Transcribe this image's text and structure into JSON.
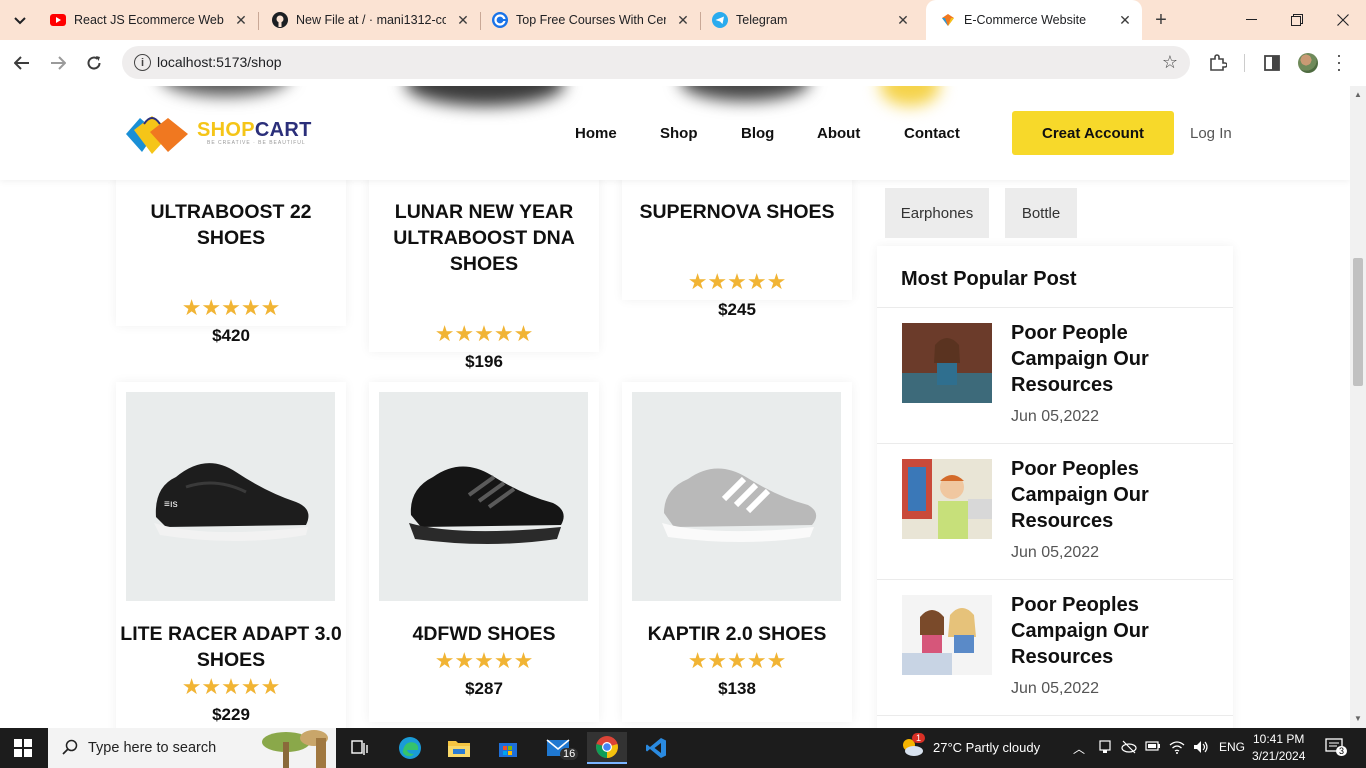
{
  "browser": {
    "tabs": [
      {
        "title": "React JS Ecommerce Website",
        "icon": "youtube-icon"
      },
      {
        "title": "New File at / · mani1312-code",
        "icon": "github-icon"
      },
      {
        "title": "Top Free Courses With Certificate",
        "icon": "course-icon"
      },
      {
        "title": "Telegram",
        "icon": "telegram-icon"
      },
      {
        "title": "E-Commerce Website",
        "icon": "site-icon",
        "active": true
      }
    ],
    "url": "localhost:5173/shop"
  },
  "site": {
    "logo": {
      "shop": "SHOP",
      "cart": "CART",
      "tagline": "BE CREATIVE · BE BEAUTIFUL"
    },
    "nav": [
      "Home",
      "Shop",
      "Blog",
      "About",
      "Contact"
    ],
    "create_account": "Creat Account",
    "login": "Log In"
  },
  "products_top": [
    {
      "name_lines": [
        "ULTRABOOST 22",
        "SHOES"
      ],
      "price": "$420",
      "rating": "★★★★★"
    },
    {
      "name_lines": [
        "LUNAR NEW YEAR",
        "ULTRABOOST DNA",
        "SHOES"
      ],
      "price": "$196",
      "rating": "★★★★★"
    },
    {
      "name_lines": [
        "SUPERNOVA SHOES"
      ],
      "price": "$245",
      "rating": "★★★★★"
    }
  ],
  "products_bottom": [
    {
      "name_lines": [
        "LITE RACER ADAPT 3.0",
        "SHOES"
      ],
      "price": "$229",
      "rating": "★★★★★"
    },
    {
      "name_lines": [
        "4DFWD SHOES"
      ],
      "price": "$287",
      "rating": "★★★★★"
    },
    {
      "name_lines": [
        "KAPTIR 2.0 SHOES"
      ],
      "price": "$138",
      "rating": "★★★★★"
    }
  ],
  "sidebar": {
    "tags": [
      "Earphones",
      "Bottle"
    ],
    "popular_title": "Most Popular Post",
    "posts": [
      {
        "title_lines": [
          "Poor People",
          "Campaign Our",
          "Resources"
        ],
        "date": "Jun 05,2022"
      },
      {
        "title_lines": [
          "Poor Peoples",
          "Campaign Our",
          "Resources"
        ],
        "date": "Jun 05,2022"
      },
      {
        "title_lines": [
          "Poor Peoples",
          "Campaign Our",
          "Resources"
        ],
        "date": "Jun 05,2022"
      }
    ]
  },
  "taskbar": {
    "search_placeholder": "Type here to search",
    "mail_badge": "16",
    "weather": "27°C  Partly cloudy",
    "weather_badge": "1",
    "lang": "ENG",
    "time": "10:41 PM",
    "date": "3/21/2024",
    "notifications": "3"
  },
  "colors": {
    "accent_yellow": "#f7d92a",
    "star": "#f1b434",
    "logo_blue": "#2b2f7a",
    "tab_bar": "#fbe3d3"
  }
}
